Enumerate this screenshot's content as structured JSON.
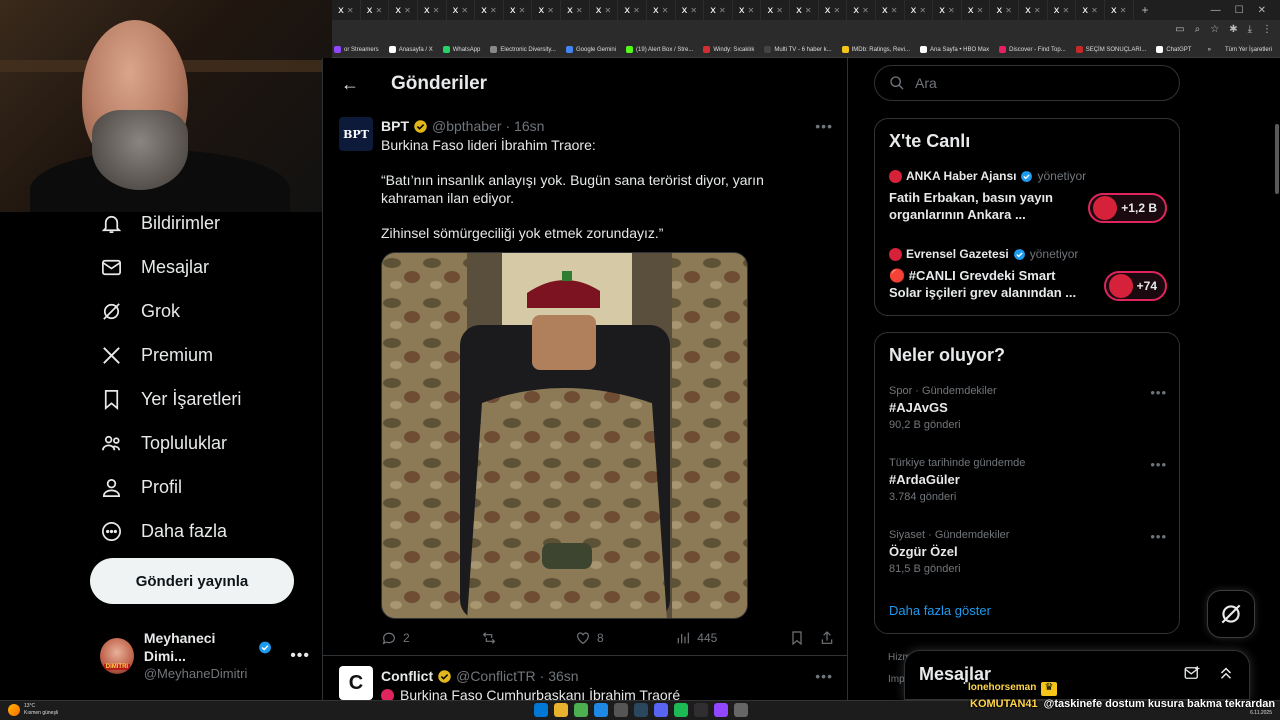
{
  "browser": {
    "tabs_count": 28,
    "tab_short_label": "x",
    "new_tab": "+",
    "bookmarks": [
      {
        "label": "or Streamers",
        "color": "#9146ff"
      },
      {
        "label": "Anasayfa / X",
        "color": "#ffffff"
      },
      {
        "label": "WhatsApp",
        "color": "#25d366"
      },
      {
        "label": "Electronic Diversity...",
        "color": "#888888"
      },
      {
        "label": "Google Gemini",
        "color": "#4285f4"
      },
      {
        "label": "(19) Alert Box / Stre...",
        "color": "#53fc18"
      },
      {
        "label": "Windy: Sıcaklık",
        "color": "#d32f2f"
      },
      {
        "label": "Multi TV - 6 haber k...",
        "color": "#444444"
      },
      {
        "label": "IMDb: Ratings, Revi...",
        "color": "#f5c518"
      },
      {
        "label": "Ana Sayfa • HBO Max",
        "color": "#ffffff"
      },
      {
        "label": "Discover - Find Top...",
        "color": "#e91e63"
      },
      {
        "label": "SEÇİM SONUÇLARI...",
        "color": "#c62828"
      },
      {
        "label": "ChatGPT",
        "color": "#ffffff"
      }
    ],
    "bookmarks_more": "»",
    "bookmarks_all": "Tüm Yer İşaretleri"
  },
  "nav": {
    "items": [
      {
        "label": "Bildirimler",
        "icon": "bell-icon"
      },
      {
        "label": "Mesajlar",
        "icon": "mail-icon"
      },
      {
        "label": "Grok",
        "icon": "grok-icon"
      },
      {
        "label": "Premium",
        "icon": "x-logo-icon"
      },
      {
        "label": "Yer İşaretleri",
        "icon": "bookmark-icon"
      },
      {
        "label": "Topluluklar",
        "icon": "communities-icon"
      },
      {
        "label": "Profil",
        "icon": "profile-icon"
      },
      {
        "label": "Daha fazla",
        "icon": "more-circle-icon"
      }
    ],
    "post_button": "Gönderi yayınla",
    "profile": {
      "name": "Meyhaneci Dimi...",
      "handle": "@MeyhaneDimitri",
      "avatar_text": "DIMITRI",
      "more": "•••"
    }
  },
  "main": {
    "back_arrow": "←",
    "title": "Gönderiler",
    "tweets": [
      {
        "avatar_text": "BPT",
        "name": "BPT",
        "handle": "@bpthaber",
        "time": "· 16sn",
        "more": "•••",
        "lines": [
          "Burkina Faso lideri İbrahim Traore:",
          "“Batı’nın insanlık anlayışı yok. Bugün sana terörist diyor, yarın kahraman ilan ediyor.",
          "Zihinsel sömürgeciliği yok etmek zorundayız.”"
        ],
        "stats": {
          "replies": "2",
          "reposts": "",
          "likes": "8",
          "views": "445"
        }
      },
      {
        "avatar_text": "C",
        "name": "Conflict",
        "handle": "@ConflictTR",
        "time": "· 36sn",
        "more": "•••",
        "lines": [
          "Burkina Faso Cumhurbaşkanı İbrahim Traoré"
        ]
      }
    ]
  },
  "right": {
    "search_placeholder": "Ara",
    "live": {
      "title": "X'te Canlı",
      "items": [
        {
          "source": "ANKA Haber Ajansı",
          "role": "yönetiyor",
          "headline": "Fatih Erbakan, basın yayın organlarının Ankara ...",
          "count": "+1,2 B"
        },
        {
          "source": "Evrensel Gazetesi",
          "role": "yönetiyor",
          "headline": "🔴 #CANLI Grevdeki Smart Solar işçileri grev alanından ...",
          "count": "+74"
        }
      ]
    },
    "trends": {
      "title": "Neler oluyor?",
      "items": [
        {
          "context": "Spor · Gündemdekiler",
          "name": "#AJAvGS",
          "count": "90,2 B gönderi"
        },
        {
          "context": "Türkiye tarihinde gündemde",
          "name": "#ArdaGüler",
          "count": "3.784 gönderi"
        },
        {
          "context": "Siyaset · Gündemdekiler",
          "name": "Özgür Özel",
          "count": "81,5 B gönderi"
        }
      ],
      "show_more": "Daha fazla göster",
      "more": "•••"
    },
    "hidden_1": "Hizm",
    "hidden_2": "Impr",
    "messages_drawer": "Mesajlar"
  },
  "taskbar": {
    "temperature": "13°C",
    "weather": "Kısmen güneşli",
    "time": "01:22",
    "date": "6.11.2025"
  },
  "overlay": {
    "follower": "lonehorseman",
    "chat_user": "KOMUTAN41",
    "chat_message": "@taskinefe dostum kusura bakma tekrardan"
  }
}
